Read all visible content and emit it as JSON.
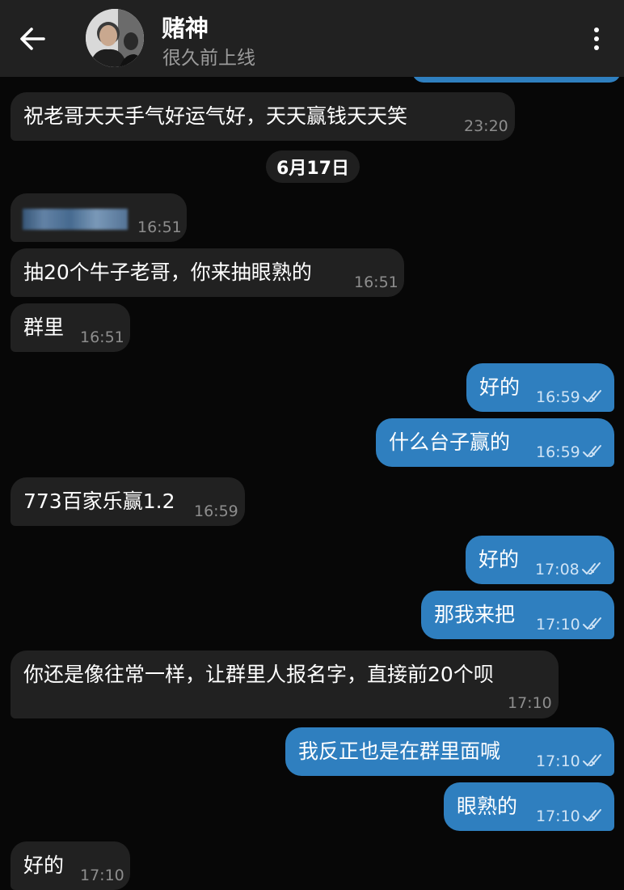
{
  "header": {
    "contact_name": "赌神",
    "status": "很久前上线",
    "icons": {
      "back": "arrow-left-icon",
      "menu": "more-vertical-icon"
    }
  },
  "colors": {
    "background": "#070707",
    "header": "#212121",
    "incoming_bubble": "#212121",
    "outgoing_bubble": "#2f7fbf",
    "incoming_time": "#8d8d8d",
    "outgoing_time": "#cfe3f5"
  },
  "date_separator": "6月17日",
  "messages": [
    {
      "dir": "in",
      "text": "祝老哥天天手气好运气好，天天赢钱天天笑",
      "time": "23:20"
    },
    {
      "dir": "in",
      "text": "",
      "time": "16:51",
      "redacted": true
    },
    {
      "dir": "in",
      "text": "抽20个牛子老哥，你来抽眼熟的",
      "time": "16:51"
    },
    {
      "dir": "in",
      "text": "群里",
      "time": "16:51"
    },
    {
      "dir": "out",
      "text": "好的",
      "time": "16:59",
      "read": true
    },
    {
      "dir": "out",
      "text": "什么台子赢的",
      "time": "16:59",
      "read": true
    },
    {
      "dir": "in",
      "text": "773百家乐赢1.2",
      "time": "16:59"
    },
    {
      "dir": "out",
      "text": "好的",
      "time": "17:08",
      "read": true
    },
    {
      "dir": "out",
      "text": "那我来把",
      "time": "17:10",
      "read": true
    },
    {
      "dir": "in",
      "text": "你还是像往常一样，让群里人报名字，直接前20个呗",
      "time": "17:10"
    },
    {
      "dir": "out",
      "text": "我反正也是在群里面喊",
      "time": "17:10",
      "read": true
    },
    {
      "dir": "out",
      "text": "眼熟的",
      "time": "17:10",
      "read": true
    },
    {
      "dir": "in",
      "text": "好的",
      "time": "17:10"
    }
  ]
}
